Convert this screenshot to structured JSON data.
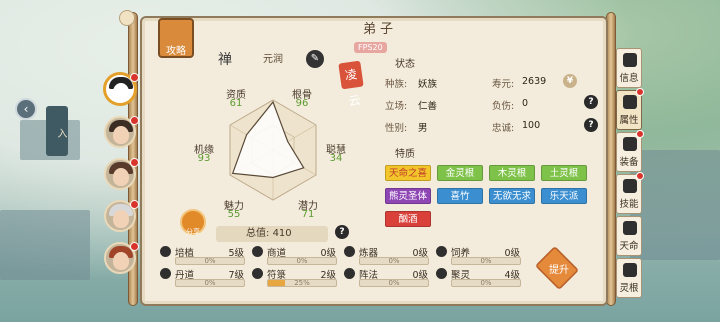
{
  "header": {
    "title": "弟子",
    "fps": "FPS20",
    "guide_label": "攻略"
  },
  "disciple": {
    "race_seal": "禅",
    "name": "元润",
    "seal_text": "凌云",
    "stats": [
      {
        "label": "资质",
        "value": "61"
      },
      {
        "label": "根骨",
        "value": "96"
      },
      {
        "label": "机缘",
        "value": "93"
      },
      {
        "label": "聪慧",
        "value": "34"
      },
      {
        "label": "魅力",
        "value": "55"
      },
      {
        "label": "潜力",
        "value": "71"
      }
    ],
    "total_label": "总值:",
    "total_value": "410",
    "share_label": "分享"
  },
  "status": {
    "heading": "状态",
    "rows": [
      {
        "label": "种族:",
        "value": "妖族",
        "label2": "寿元:",
        "value2": "2639"
      },
      {
        "label": "立场:",
        "value": "仁善",
        "label2": "负伤:",
        "value2": "0"
      },
      {
        "label": "性别:",
        "value": "男",
        "label2": "忠诚:",
        "value2": "100"
      }
    ]
  },
  "traits": {
    "heading": "特质",
    "items": [
      {
        "label": "天命之喜",
        "color": "#f2c62b",
        "text": "#c0392b"
      },
      {
        "label": "金灵根",
        "color": "#7fc24a",
        "text": "#ffffff"
      },
      {
        "label": "木灵根",
        "color": "#7fc24a",
        "text": "#ffffff"
      },
      {
        "label": "土灵根",
        "color": "#7fc24a",
        "text": "#ffffff"
      },
      {
        "label": "熊灵圣体",
        "color": "#8f46b5",
        "text": "#ffffff"
      },
      {
        "label": "喜竹",
        "color": "#3b8fd0",
        "text": "#ffffff"
      },
      {
        "label": "无欲无求",
        "color": "#3b8fd0",
        "text": "#ffffff"
      },
      {
        "label": "乐天派",
        "color": "#3b8fd0",
        "text": "#ffffff"
      },
      {
        "label": "酗酒",
        "color": "#d9403a",
        "text": "#ffffff"
      }
    ]
  },
  "skills": [
    {
      "name": "培植",
      "level": "5级",
      "progress": "0%",
      "fill": 0
    },
    {
      "name": "商道",
      "level": "0级",
      "progress": "0%",
      "fill": 0
    },
    {
      "name": "炼器",
      "level": "0级",
      "progress": "0%",
      "fill": 0
    },
    {
      "name": "饲养",
      "level": "0级",
      "progress": "0%",
      "fill": 0
    },
    {
      "name": "丹道",
      "level": "7级",
      "progress": "0%",
      "fill": 0
    },
    {
      "name": "符箓",
      "level": "2级",
      "progress": "25%",
      "fill": 0.25
    },
    {
      "name": "阵法",
      "level": "0级",
      "progress": "0%",
      "fill": 0
    },
    {
      "name": "聚灵",
      "level": "4级",
      "progress": "0%",
      "fill": 0
    }
  ],
  "upgrade_label": "提升",
  "side_tabs": [
    {
      "label": "信息",
      "icon": "scroll-icon"
    },
    {
      "label": "属性",
      "icon": "attribute-icon"
    },
    {
      "label": "装备",
      "icon": "equipment-icon"
    },
    {
      "label": "技能",
      "icon": "skill-icon"
    },
    {
      "label": "天命",
      "icon": "destiny-icon"
    },
    {
      "label": "灵根",
      "icon": "spirit-root-icon"
    }
  ],
  "map_tag": "入"
}
